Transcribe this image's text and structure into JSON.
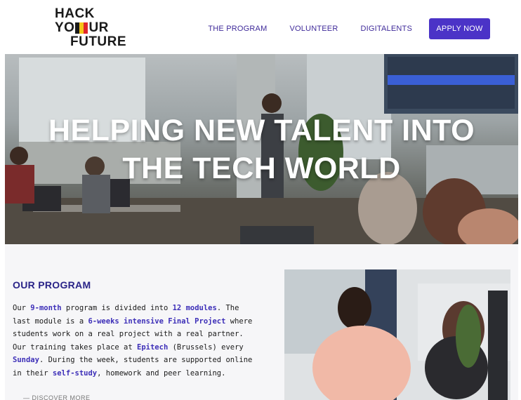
{
  "header": {
    "logo": {
      "line1": "HACK",
      "line2_pre": "YO",
      "line2_post": "UR",
      "line3": "FUTURE"
    },
    "nav": [
      {
        "label": "THE PROGRAM"
      },
      {
        "label": "VOLUNTEER"
      },
      {
        "label": "DIGITALENTS"
      }
    ],
    "apply_label": "APPLY NOW"
  },
  "hero": {
    "title_line1": "HELPING NEW TALENT INTO",
    "title_line2": "THE TECH WORLD"
  },
  "program": {
    "title": "OUR PROGRAM",
    "p1": "Our ",
    "h1": "9-month",
    "p2": " program is divided into ",
    "h2": "12 modules",
    "p3": ". The last module is a ",
    "h3": "6-weeks intensive Final Project",
    "p4": " where students work on a real project with a real partner. Our training takes place at ",
    "h4": "Epitech",
    "p5": " (Brussels) every ",
    "h5": "Sunday",
    "p6": ". During the week, students are supported online in their ",
    "h6": "self-study",
    "p7": ", homework and peer learning.",
    "discover": "— DISCOVER MORE"
  },
  "colors": {
    "accent": "#4b33c7",
    "nav_text": "#3f2a9a",
    "title": "#2a2488"
  }
}
